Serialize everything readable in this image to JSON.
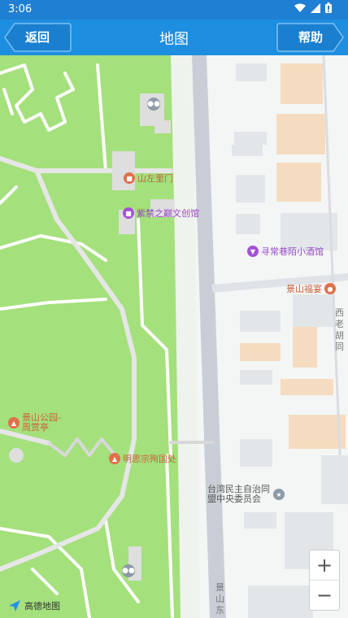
{
  "status_bar": {
    "time": "3:06",
    "icons": [
      "wifi-icon",
      "signal-icon",
      "battery-icon"
    ]
  },
  "app_bar": {
    "back_label": "返回",
    "title": "地图",
    "help_label": "帮助",
    "color": "#1e8ee0"
  },
  "map": {
    "pois": [
      {
        "name": "山左里门",
        "kind": "gate"
      },
      {
        "name": "紫禁之巅文创馆",
        "kind": "shop"
      },
      {
        "name": "寻常巷陌小酒馆",
        "kind": "bar"
      },
      {
        "name": "景山福宴",
        "kind": "restaurant"
      },
      {
        "name_line1": "景山公园-",
        "name_line2": "周赏亭",
        "kind": "scenic"
      },
      {
        "name": "明思宗殉国处",
        "kind": "scenic"
      },
      {
        "name_line1": "台湾民主自治同",
        "name_line2": "盟中央委员会",
        "kind": "government"
      }
    ],
    "streets": [
      {
        "name": "西老胡同"
      },
      {
        "name": "景山东"
      }
    ],
    "icons": [
      "toilet-icon"
    ]
  },
  "zoom": {
    "in_label": "+",
    "out_label": "−"
  },
  "logo": {
    "text": "高德地图"
  }
}
